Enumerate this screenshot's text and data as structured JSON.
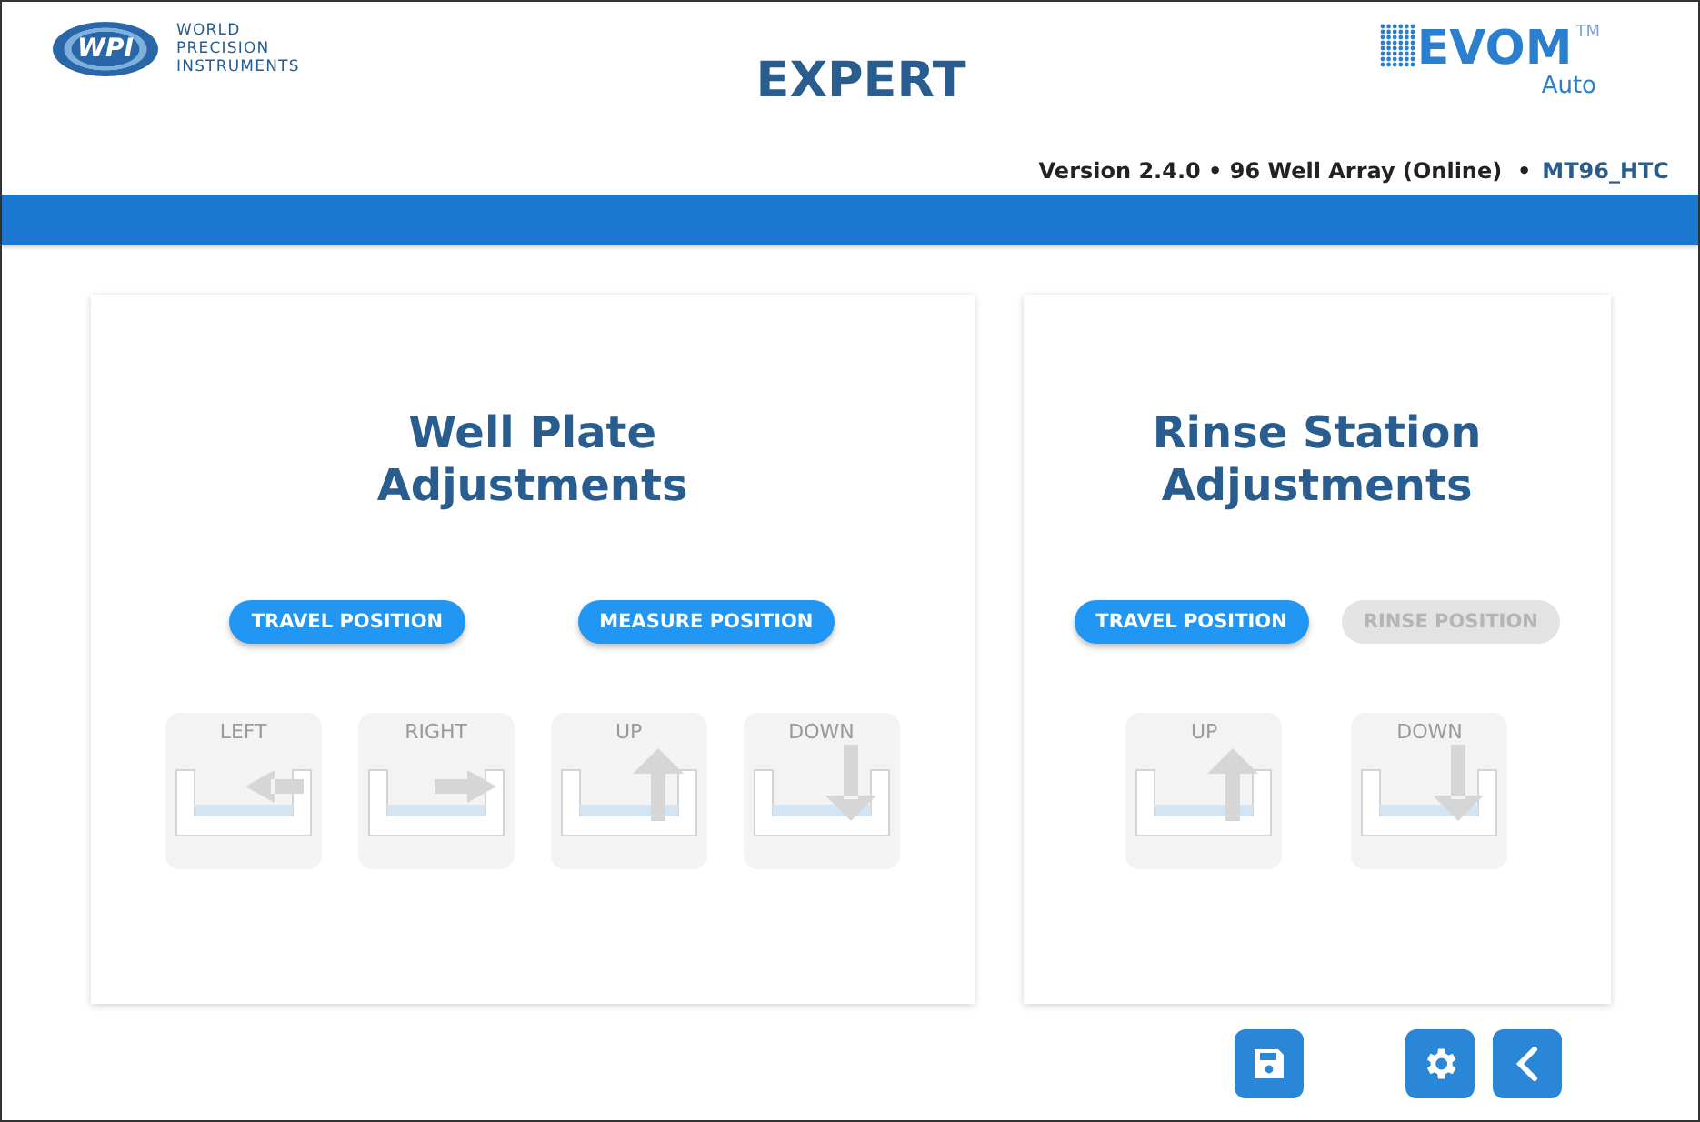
{
  "header": {
    "logo": {
      "mark": "WPI",
      "lines": [
        "WORLD",
        "PRECISION",
        "INSTRUMENTS"
      ]
    },
    "title": "EXPERT",
    "product": {
      "name": "EVOM",
      "trademark": "TM",
      "edition": "Auto"
    },
    "status": {
      "text": "Version 2.4.0 • 96 Well Array (Online)  •",
      "device": "MT96_HTC"
    }
  },
  "panels": [
    {
      "title": "Well Plate Adjustments",
      "positions": [
        {
          "label": "TRAVEL POSITION",
          "disabled": false
        },
        {
          "label": "MEASURE POSITION",
          "disabled": false
        }
      ],
      "jogs": [
        {
          "kind": "left",
          "label": "LEFT",
          "disabled": true
        },
        {
          "kind": "right",
          "label": "RIGHT",
          "disabled": true
        },
        {
          "kind": "up",
          "label": "UP",
          "disabled": true
        },
        {
          "kind": "down",
          "label": "DOWN",
          "disabled": true
        }
      ]
    },
    {
      "title": "Rinse Station Adjustments",
      "positions": [
        {
          "label": "TRAVEL POSITION",
          "disabled": false
        },
        {
          "label": "RINSE POSITION",
          "disabled": true
        }
      ],
      "jogs": [
        {
          "kind": "up",
          "label": "UP",
          "disabled": true
        },
        {
          "kind": "down",
          "label": "DOWN",
          "disabled": true
        }
      ]
    }
  ],
  "footer": [
    {
      "kind": "save"
    },
    {
      "kind": "settings"
    },
    {
      "kind": "back"
    }
  ]
}
